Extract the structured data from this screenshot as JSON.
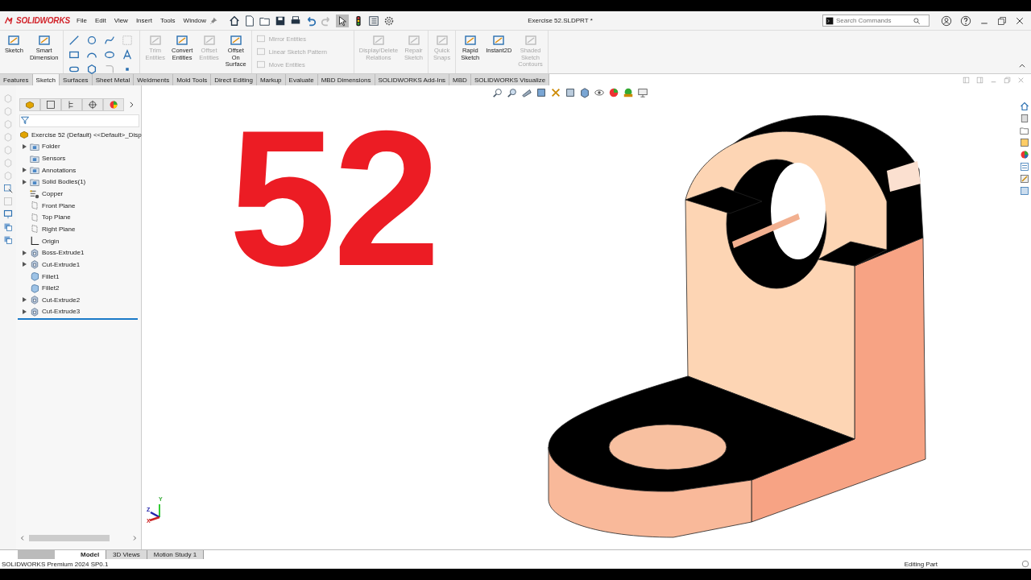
{
  "app": {
    "logo": "SOLIDWORKS"
  },
  "menu": [
    "File",
    "Edit",
    "View",
    "Insert",
    "Tools",
    "Window"
  ],
  "window": {
    "title": "Exercise 52.SLDPRT *"
  },
  "search": {
    "placeholder": "Search Commands"
  },
  "ribbon": {
    "groups": [
      {
        "items": [
          {
            "kind": "large",
            "label": "Sketch",
            "disabled": false
          },
          {
            "kind": "large",
            "label": "Smart\nDimension",
            "disabled": false
          }
        ]
      },
      {
        "items": [
          {
            "kind": "grid"
          }
        ]
      },
      {
        "items": [
          {
            "kind": "large",
            "label": "Trim\nEntities",
            "disabled": true
          },
          {
            "kind": "large",
            "label": "Convert\nEntities",
            "disabled": false
          },
          {
            "kind": "large",
            "label": "Offset\nEntities",
            "disabled": true
          },
          {
            "kind": "large",
            "label": "Offset\nOn\nSurface",
            "disabled": false
          }
        ]
      },
      {
        "items": [
          {
            "kind": "small",
            "label": "Mirror Entities",
            "disabled": true
          },
          {
            "kind": "small",
            "label": "Linear Sketch Pattern",
            "disabled": true
          },
          {
            "kind": "small",
            "label": "Move Entities",
            "disabled": true
          }
        ]
      },
      {
        "items": [
          {
            "kind": "large",
            "label": "Display/Delete\nRelations",
            "disabled": true
          },
          {
            "kind": "large",
            "label": "Repair\nSketch",
            "disabled": true
          }
        ]
      },
      {
        "items": [
          {
            "kind": "large",
            "label": "Quick\nSnaps",
            "disabled": true
          }
        ]
      },
      {
        "items": [
          {
            "kind": "large",
            "label": "Rapid\nSketch",
            "disabled": false
          },
          {
            "kind": "large",
            "label": "Instant2D",
            "disabled": false
          },
          {
            "kind": "large",
            "label": "Shaded\nSketch\nContours",
            "disabled": true
          }
        ]
      }
    ]
  },
  "tabs": [
    {
      "label": "Features",
      "selected": false
    },
    {
      "label": "Sketch",
      "selected": true
    },
    {
      "label": "Surfaces",
      "selected": false
    },
    {
      "label": "Sheet Metal",
      "selected": false
    },
    {
      "label": "Weldments",
      "selected": false
    },
    {
      "label": "Mold Tools",
      "selected": false
    },
    {
      "label": "Direct Editing",
      "selected": false
    },
    {
      "label": "Markup",
      "selected": false
    },
    {
      "label": "Evaluate",
      "selected": false
    },
    {
      "label": "MBD Dimensions",
      "selected": false
    },
    {
      "label": "SOLIDWORKS Add-Ins",
      "selected": false
    },
    {
      "label": "MBD",
      "selected": false
    },
    {
      "label": "SOLIDWORKS Visualize",
      "selected": false
    }
  ],
  "feature_tree": {
    "root": "Exercise 52 (Default) <<Default>_Disp",
    "items": [
      {
        "label": "Folder",
        "kind": "folder",
        "collapsed": true
      },
      {
        "label": "Sensors",
        "kind": "folder",
        "collapsed": false
      },
      {
        "label": "Annotations",
        "kind": "folder",
        "collapsed": true
      },
      {
        "label": "Solid Bodies(1)",
        "kind": "folder",
        "collapsed": true
      },
      {
        "label": "Copper",
        "kind": "material",
        "collapsed": false
      },
      {
        "label": "Front Plane",
        "kind": "plane",
        "collapsed": false
      },
      {
        "label": "Top Plane",
        "kind": "plane",
        "collapsed": false
      },
      {
        "label": "Right Plane",
        "kind": "plane",
        "collapsed": false
      },
      {
        "label": "Origin",
        "kind": "origin",
        "collapsed": false
      },
      {
        "label": "Boss-Extrude1",
        "kind": "feature",
        "collapsed": true
      },
      {
        "label": "Cut-Extrude1",
        "kind": "feature",
        "collapsed": true
      },
      {
        "label": "Fillet1",
        "kind": "fillet",
        "collapsed": false
      },
      {
        "label": "Fillet2",
        "kind": "fillet",
        "collapsed": false
      },
      {
        "label": "Cut-Extrude2",
        "kind": "feature",
        "collapsed": true
      },
      {
        "label": "Cut-Extrude3",
        "kind": "feature",
        "collapsed": true
      }
    ]
  },
  "viewport": {
    "overlay_text": "52",
    "triad": {
      "x": "X",
      "y": "Y",
      "z": "Z"
    }
  },
  "bottom_tabs": [
    {
      "label": "Model",
      "selected": true
    },
    {
      "label": "3D Views",
      "selected": false
    },
    {
      "label": "Motion Study 1",
      "selected": false
    }
  ],
  "status_bar": {
    "product": "SOLIDWORKS Premium 2024 SP0.1",
    "mode": "Editing Part"
  }
}
